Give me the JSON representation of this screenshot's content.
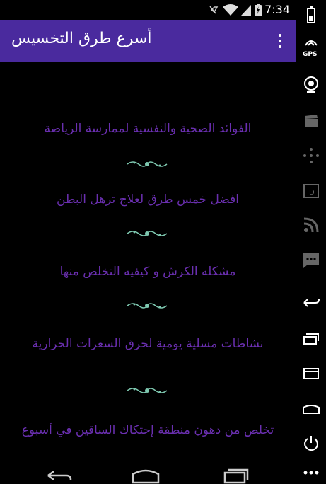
{
  "status_bar": {
    "time": "7:34",
    "icons": [
      "mute-icon",
      "wifi-icon",
      "battery-icon"
    ]
  },
  "app_bar": {
    "title": "أسرع طرق التخسيس",
    "overflow_icon": "more-vert-icon",
    "color": "#4a2a9e"
  },
  "list": {
    "text_color": "#6a2fb0",
    "ornament_color": "#7ec8b0",
    "items": [
      {
        "label": "الفوائد الصحية والنفسية لممارسة الرياضة"
      },
      {
        "label": "افضل خمس طرق لعلاج ترهل البطن"
      },
      {
        "label": "مشكله الكرش و كيفيه التخلص منها"
      },
      {
        "label": "نشاطات مسلية يومية لحرق السعرات الحرارية"
      },
      {
        "label": "تخلص من دهون منطقة إحتكاك الساقين في أسبوع"
      }
    ]
  },
  "side_toolbar": {
    "gps_label": "GPS",
    "icons": [
      "battery-icon",
      "gps-icon",
      "camera-icon",
      "clapper-icon",
      "dpad-icon",
      "id-icon",
      "rss-icon",
      "sms-icon",
      "back-icon",
      "recent-apps-icon",
      "menu-icon",
      "home-icon",
      "power-icon",
      "more-icon"
    ]
  },
  "nav_bar": {
    "buttons": [
      "back-icon",
      "home-icon",
      "recents-icon"
    ]
  }
}
